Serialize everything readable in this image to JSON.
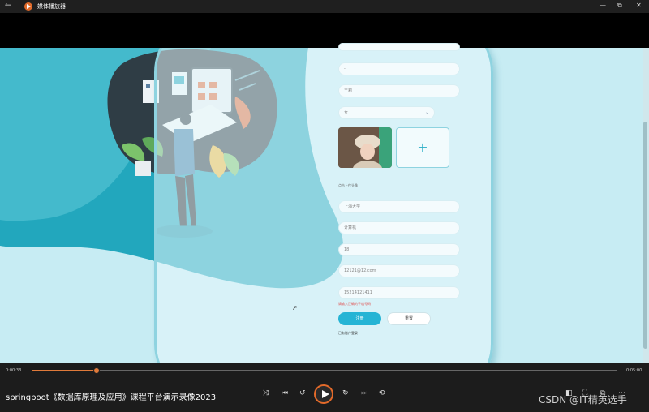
{
  "titlebar": {
    "back_icon": "←",
    "title": "媒体播放器",
    "minimize_icon": "—",
    "maximize_icon": "⧉",
    "close_icon": "✕"
  },
  "form": {
    "field_blank": "",
    "field_dash": "-",
    "field_name": "王莉",
    "select_gender": "女",
    "avatar_plus": "+",
    "avatar_hint": "点击上传头像",
    "field_school": "上海大学",
    "field_major": "计算机",
    "field_age": "18",
    "field_email": "12121@12.com",
    "field_phone": "15214121411",
    "error_text": "请输入正确的手机号码",
    "register_label": "注册",
    "reset_label": "重置",
    "login_link": "已有账户登录"
  },
  "player": {
    "current_time": "0:00:33",
    "total_time": "0:05:00",
    "progress_fraction": 0.11,
    "video_title": "springboot《数据库原理及应用》课程平台演示录像2023",
    "watermark": "CSDN @IT精英选手"
  },
  "colors": {
    "accent": "#25b4d5",
    "player_accent": "#e07a3a"
  }
}
